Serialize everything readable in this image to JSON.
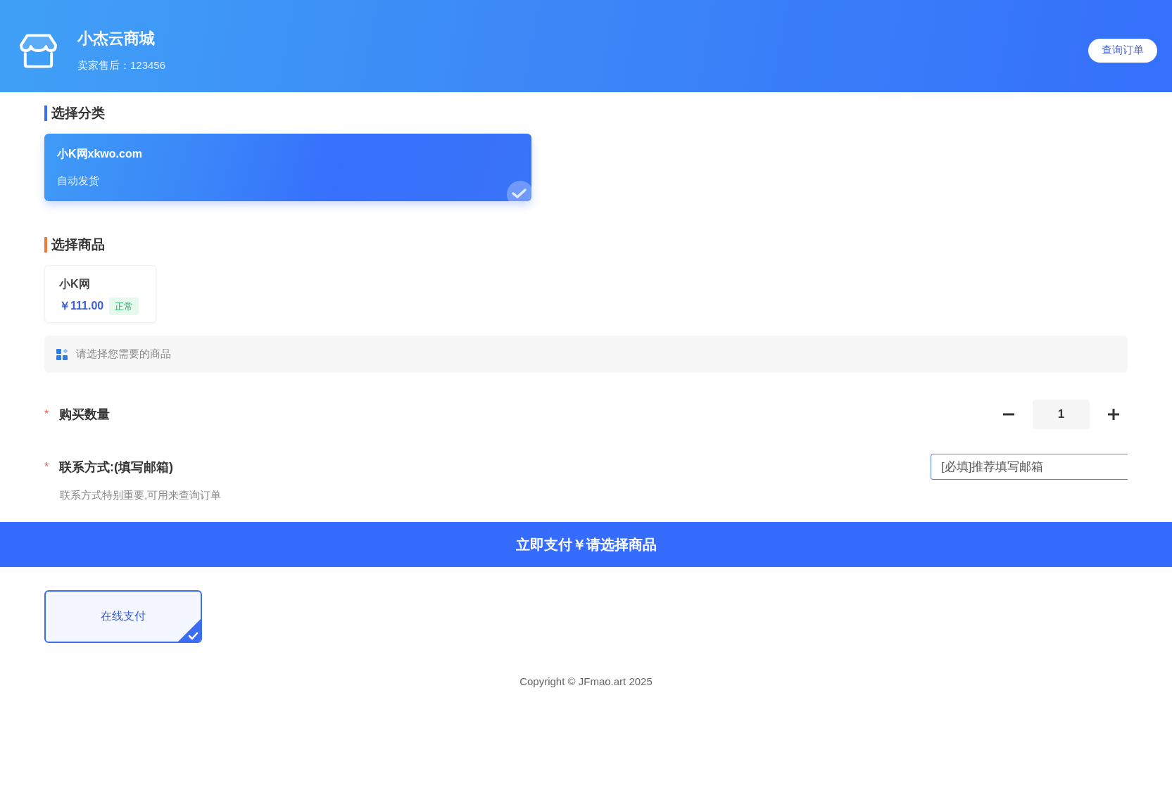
{
  "header": {
    "title": "小杰云商城",
    "subtitle": "卖家售后：123456",
    "query_button": "查询订单"
  },
  "category_section": {
    "heading": "选择分类",
    "categories": [
      {
        "name": "小K网xkwo.com",
        "tag": "自动发货",
        "selected": true
      }
    ]
  },
  "product_section": {
    "heading": "选择商品",
    "products": [
      {
        "name": "小K网",
        "price": "￥111.00",
        "status": "正常",
        "selected": false
      }
    ],
    "hint": "请选择您需要的商品"
  },
  "quantity": {
    "required_mark": "*",
    "label": "购买数量",
    "value": "1"
  },
  "contact": {
    "required_mark": "*",
    "label": "联系方式:(填写邮箱)",
    "placeholder": "[必填]推荐填写邮箱",
    "note": "联系方式特别重要,可用来查询订单"
  },
  "pay_bar": {
    "label": "立即支付￥请选择商品"
  },
  "payment_methods": [
    {
      "label": "在线支付",
      "selected": true
    }
  ],
  "footer": {
    "copyright": "Copyright © JFmao.art 2025"
  }
}
